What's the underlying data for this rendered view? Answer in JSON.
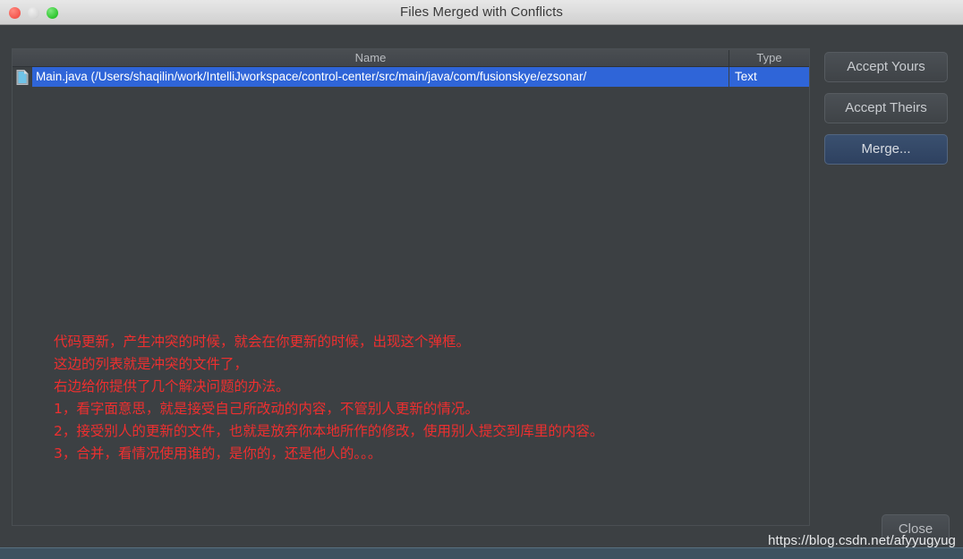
{
  "window": {
    "title": "Files Merged with Conflicts",
    "traffic_lights": [
      {
        "name": "close",
        "color": "#f4574f"
      },
      {
        "name": "minimize",
        "color": "#d6d6d6"
      },
      {
        "name": "zoom",
        "color": "#2fc62f"
      }
    ]
  },
  "file_table": {
    "columns": [
      {
        "key": "name",
        "label": "Name"
      },
      {
        "key": "type",
        "label": "Type"
      }
    ],
    "rows": [
      {
        "icon": "file-document-icon",
        "name": "Main.java (/Users/shaqilin/work/IntelliJworkspace/control-center/src/main/java/com/fusionskye/ezsonar/",
        "type": "Text",
        "selected": true
      }
    ],
    "selection_color": "#2f65d8"
  },
  "actions": {
    "accept_yours": "Accept Yours",
    "accept_theirs": "Accept Theirs",
    "merge": "Merge...",
    "close": "Close"
  },
  "annotation": {
    "color": "#ee2f2f",
    "lines": [
      "代码更新，产生冲突的时候，就会在你更新的时候，出现这个弹框。",
      "这边的列表就是冲突的文件了，",
      "右边给你提供了几个解决问题的办法。",
      "1，看字面意思，就是接受自己所改动的内容，不管别人更新的情况。",
      "2，接受别人的更新的文件，也就是放弃你本地所作的修改，使用别人提交到库里的内容。",
      "3，合并，看情况使用谁的，是你的，还是他人的。。。"
    ]
  },
  "watermark": {
    "text": "https://blog.csdn.net/afyyugyug"
  }
}
